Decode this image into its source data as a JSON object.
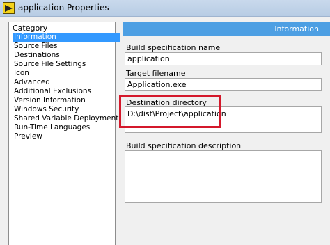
{
  "window": {
    "title": "application Properties"
  },
  "category": {
    "header": "Category",
    "items": [
      "Information",
      "Source Files",
      "Destinations",
      "Source File Settings",
      "Icon",
      "Advanced",
      "Additional Exclusions",
      "Version Information",
      "Windows Security",
      "Shared Variable Deployment",
      "Run-Time Languages",
      "Preview"
    ],
    "selected": "Information"
  },
  "panel": {
    "header": "Information"
  },
  "form": {
    "build_spec_name_label": "Build specification name",
    "build_spec_name_value": "application",
    "target_filename_label": "Target filename",
    "target_filename_value": "Application.exe",
    "destination_dir_label": "Destination directory",
    "destination_dir_value": "D:\\dist\\Project\\application",
    "build_spec_desc_label": "Build specification description",
    "build_spec_desc_value": ""
  },
  "colors": {
    "header_blue": "#4d9fe3",
    "selection_blue": "#3399ff",
    "highlight_red": "#d4182b"
  }
}
